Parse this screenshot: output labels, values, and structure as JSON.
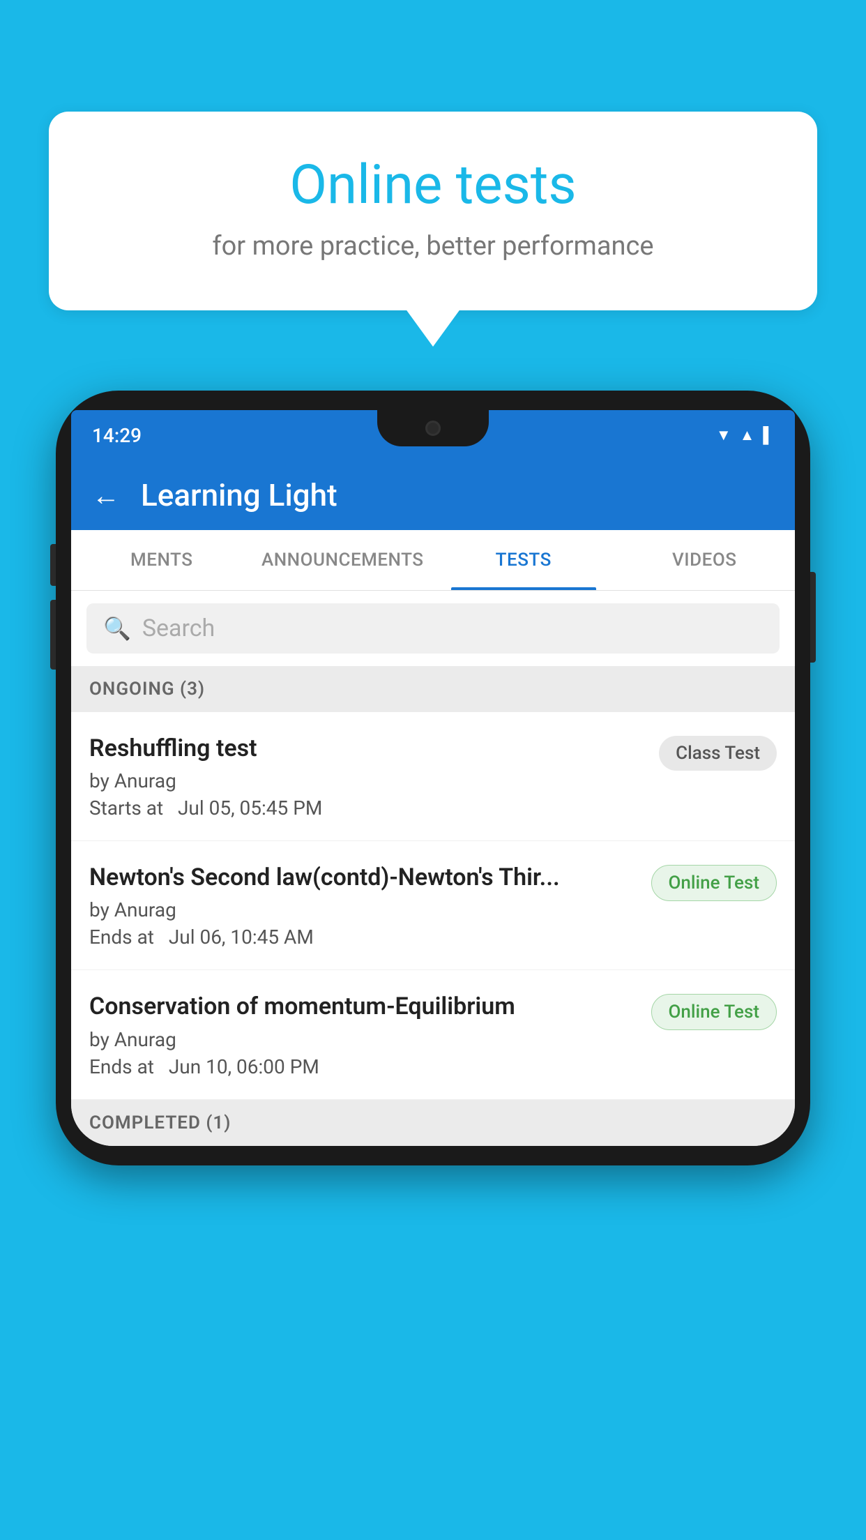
{
  "background_color": "#1ab8e8",
  "speech_bubble": {
    "title": "Online tests",
    "subtitle": "for more practice, better performance"
  },
  "phone": {
    "status_bar": {
      "time": "14:29",
      "icons": [
        "wifi",
        "signal",
        "battery"
      ]
    },
    "app_bar": {
      "back_label": "←",
      "title": "Learning Light"
    },
    "tabs": [
      {
        "label": "MENTS",
        "active": false
      },
      {
        "label": "ANNOUNCEMENTS",
        "active": false
      },
      {
        "label": "TESTS",
        "active": true
      },
      {
        "label": "VIDEOS",
        "active": false
      }
    ],
    "search": {
      "placeholder": "Search",
      "icon": "🔍"
    },
    "ongoing_section": {
      "header": "ONGOING (3)",
      "tests": [
        {
          "title": "Reshuffling test",
          "author": "by Anurag",
          "date_label": "Starts at",
          "date": "Jul 05, 05:45 PM",
          "badge": "Class Test",
          "badge_type": "class"
        },
        {
          "title": "Newton's Second law(contd)-Newton's Thir...",
          "author": "by Anurag",
          "date_label": "Ends at",
          "date": "Jul 06, 10:45 AM",
          "badge": "Online Test",
          "badge_type": "online"
        },
        {
          "title": "Conservation of momentum-Equilibrium",
          "author": "by Anurag",
          "date_label": "Ends at",
          "date": "Jun 10, 06:00 PM",
          "badge": "Online Test",
          "badge_type": "online"
        }
      ]
    },
    "completed_section": {
      "header": "COMPLETED (1)"
    }
  }
}
